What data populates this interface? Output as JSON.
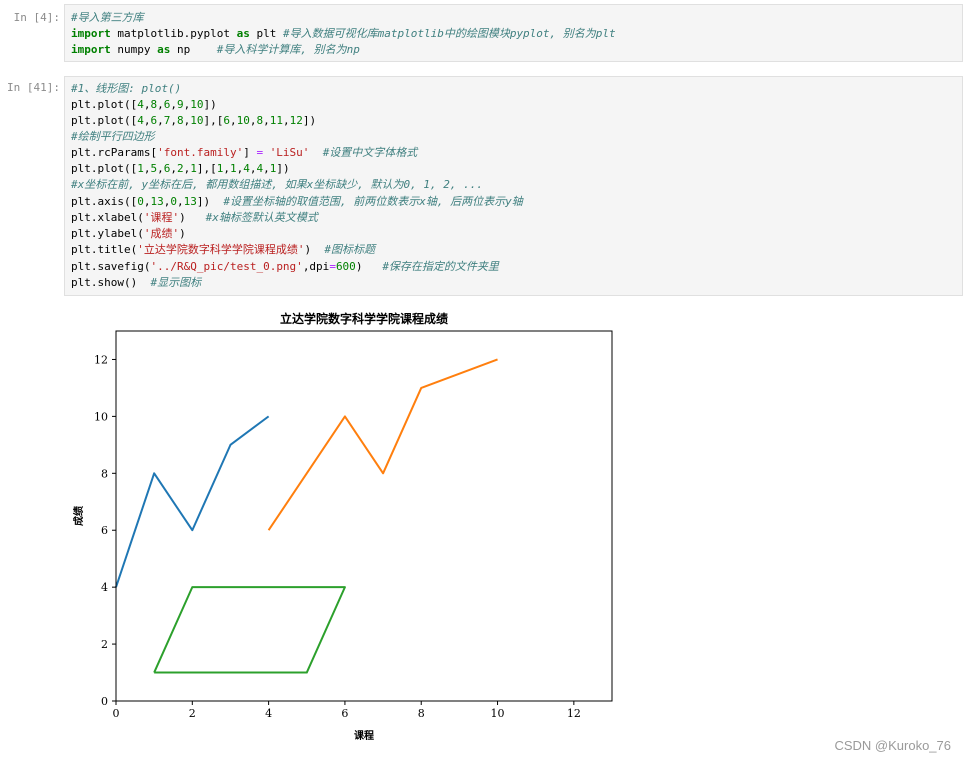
{
  "cells": [
    {
      "prompt": "In [4]:",
      "lines": [
        [
          [
            "cm",
            "#导入第三方库"
          ]
        ],
        [
          [
            "kw",
            "import"
          ],
          [
            "tx",
            " matplotlib.pyplot "
          ],
          [
            "kw",
            "as"
          ],
          [
            "tx",
            " plt "
          ],
          [
            "cm",
            "#导入数据可视化库matplotlib中的绘图模块pyplot, 别名为plt"
          ]
        ],
        [
          [
            "kw",
            "import"
          ],
          [
            "tx",
            " numpy "
          ],
          [
            "kw",
            "as"
          ],
          [
            "tx",
            " np    "
          ],
          [
            "cm",
            "#导入科学计算库, 别名为np"
          ]
        ]
      ]
    },
    {
      "prompt": "In [41]:",
      "lines": [
        [
          [
            "cm",
            "#1、线形图: plot()"
          ]
        ],
        [
          [
            "tx",
            "plt.plot(["
          ],
          [
            "nu",
            "4"
          ],
          [
            "tx",
            ","
          ],
          [
            "nu",
            "8"
          ],
          [
            "tx",
            ","
          ],
          [
            "nu",
            "6"
          ],
          [
            "tx",
            ","
          ],
          [
            "nu",
            "9"
          ],
          [
            "tx",
            ","
          ],
          [
            "nu",
            "10"
          ],
          [
            "tx",
            "])"
          ]
        ],
        [
          [
            "tx",
            "plt.plot(["
          ],
          [
            "nu",
            "4"
          ],
          [
            "tx",
            ","
          ],
          [
            "nu",
            "6"
          ],
          [
            "tx",
            ","
          ],
          [
            "nu",
            "7"
          ],
          [
            "tx",
            ","
          ],
          [
            "nu",
            "8"
          ],
          [
            "tx",
            ","
          ],
          [
            "nu",
            "10"
          ],
          [
            "tx",
            "],["
          ],
          [
            "nu",
            "6"
          ],
          [
            "tx",
            ","
          ],
          [
            "nu",
            "10"
          ],
          [
            "tx",
            ","
          ],
          [
            "nu",
            "8"
          ],
          [
            "tx",
            ","
          ],
          [
            "nu",
            "11"
          ],
          [
            "tx",
            ","
          ],
          [
            "nu",
            "12"
          ],
          [
            "tx",
            "])"
          ]
        ],
        [
          [
            "cm",
            "#绘制平行四边形"
          ]
        ],
        [
          [
            "tx",
            "plt.rcParams["
          ],
          [
            "st",
            "'font.family'"
          ],
          [
            "tx",
            "] "
          ],
          [
            "op",
            "="
          ],
          [
            "tx",
            " "
          ],
          [
            "st",
            "'LiSu'"
          ],
          [
            "tx",
            "  "
          ],
          [
            "cm",
            "#设置中文字体格式"
          ]
        ],
        [
          [
            "tx",
            "plt.plot(["
          ],
          [
            "nu",
            "1"
          ],
          [
            "tx",
            ","
          ],
          [
            "nu",
            "5"
          ],
          [
            "tx",
            ","
          ],
          [
            "nu",
            "6"
          ],
          [
            "tx",
            ","
          ],
          [
            "nu",
            "2"
          ],
          [
            "tx",
            ","
          ],
          [
            "nu",
            "1"
          ],
          [
            "tx",
            "],["
          ],
          [
            "nu",
            "1"
          ],
          [
            "tx",
            ","
          ],
          [
            "nu",
            "1"
          ],
          [
            "tx",
            ","
          ],
          [
            "nu",
            "4"
          ],
          [
            "tx",
            ","
          ],
          [
            "nu",
            "4"
          ],
          [
            "tx",
            ","
          ],
          [
            "nu",
            "1"
          ],
          [
            "tx",
            "])"
          ]
        ],
        [
          [
            "cm",
            "#x坐标在前, y坐标在后, 都用数组描述, 如果x坐标缺少, 默认为0, 1, 2, ..."
          ]
        ],
        [
          [
            "tx",
            "plt.axis(["
          ],
          [
            "nu",
            "0"
          ],
          [
            "tx",
            ","
          ],
          [
            "nu",
            "13"
          ],
          [
            "tx",
            ","
          ],
          [
            "nu",
            "0"
          ],
          [
            "tx",
            ","
          ],
          [
            "nu",
            "13"
          ],
          [
            "tx",
            "])  "
          ],
          [
            "cm",
            "#设置坐标轴的取值范围, 前两位数表示x轴, 后两位表示y轴"
          ]
        ],
        [
          [
            "tx",
            "plt.xlabel("
          ],
          [
            "st",
            "'课程'"
          ],
          [
            "tx",
            ")   "
          ],
          [
            "cm",
            "#x轴标签默认英文模式"
          ]
        ],
        [
          [
            "tx",
            "plt.ylabel("
          ],
          [
            "st",
            "'成绩'"
          ],
          [
            "tx",
            ")"
          ]
        ],
        [
          [
            "tx",
            "plt.title("
          ],
          [
            "st",
            "'立达学院数字科学学院课程成绩'"
          ],
          [
            "tx",
            ")  "
          ],
          [
            "cm",
            "#图标标题"
          ]
        ],
        [
          [
            "tx",
            "plt.savefig("
          ],
          [
            "st",
            "'../R&Q_pic/test_0.png'"
          ],
          [
            "tx",
            ",dpi"
          ],
          [
            "op",
            "="
          ],
          [
            "nu",
            "600"
          ],
          [
            "tx",
            ")   "
          ],
          [
            "cm",
            "#保存在指定的文件夹里"
          ]
        ],
        [
          [
            "tx",
            "plt.show()  "
          ],
          [
            "cm",
            "#显示图标"
          ]
        ]
      ]
    }
  ],
  "chart_data": {
    "type": "line",
    "title": "立达学院数字科学学院课程成绩",
    "xlabel": "课程",
    "ylabel": "成绩",
    "xlim": [
      0,
      13
    ],
    "ylim": [
      0,
      13
    ],
    "xticks": [
      0,
      2,
      4,
      6,
      8,
      10,
      12
    ],
    "yticks": [
      0,
      2,
      4,
      6,
      8,
      10,
      12
    ],
    "series": [
      {
        "color": "#1f77b4",
        "x": [
          0,
          1,
          2,
          3,
          4
        ],
        "y": [
          4,
          8,
          6,
          9,
          10
        ]
      },
      {
        "color": "#ff7f0e",
        "x": [
          4,
          6,
          7,
          8,
          10
        ],
        "y": [
          6,
          10,
          8,
          11,
          12
        ]
      },
      {
        "color": "#2ca02c",
        "x": [
          1,
          5,
          6,
          2,
          1
        ],
        "y": [
          1,
          1,
          4,
          4,
          1
        ]
      }
    ]
  },
  "watermark": "CSDN @Kuroko_76"
}
